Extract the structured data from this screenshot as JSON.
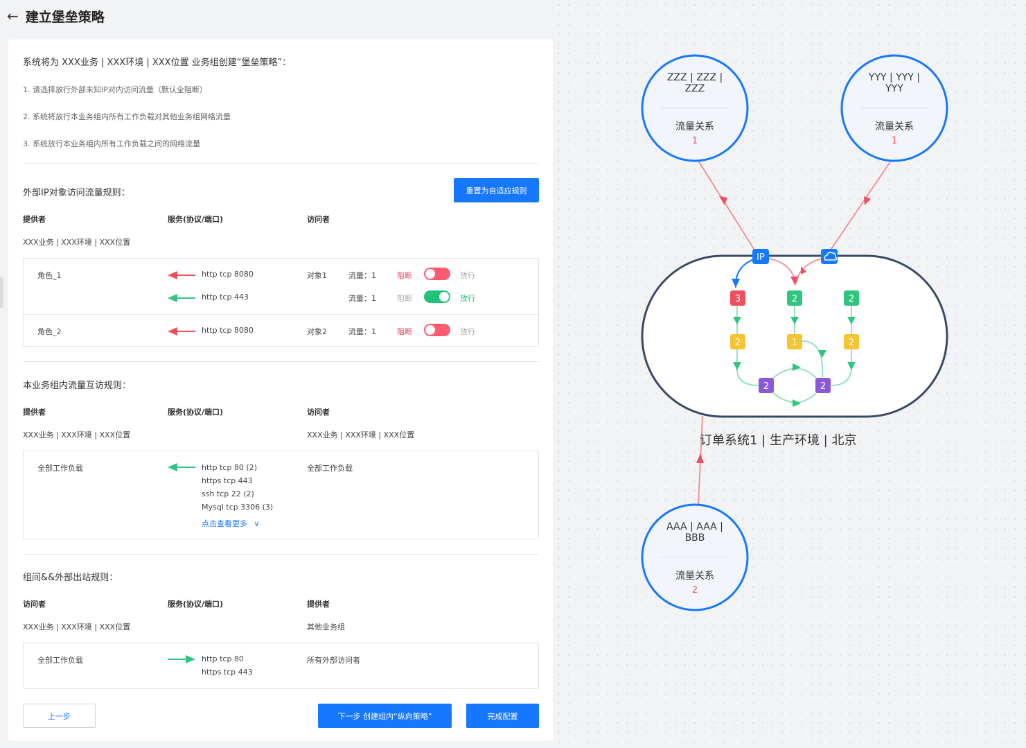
{
  "header": {
    "back_icon": "arrow-left-icon",
    "title": "建立堡垒策略"
  },
  "intro": {
    "title": "系统将为 XXX业务 | XXX环境 | XXX位置 业务组创建“堡垒策略”：",
    "lines": [
      "1. 请选择放行外部未知IP对内访问流量（默认全阻断）",
      "2. 系统将放行本业务组内所有工作负载对其他业务组网络流量",
      "3. 系统放行本业务组内所有工作负载之间的网络流量"
    ]
  },
  "external": {
    "title": "外部IP对象访问流量规则：",
    "reset_button": "重置为自适应规则",
    "headers": {
      "provider": "提供者",
      "service": "服务(协议/端口)",
      "visitor": "访问者"
    },
    "provider_value": "XXX业务 | XXX环境 | XXX位置",
    "rows": [
      {
        "role": "角色_1",
        "service": "http tcp 8080",
        "object": "对象1",
        "flow": "流量：1",
        "block": "阻断",
        "allow": "放行",
        "state": "block",
        "arrow": "red"
      },
      {
        "role": "",
        "service": "http tcp 443",
        "object": "",
        "flow": "流量：1",
        "block": "阻断",
        "allow": "放行",
        "state": "allow",
        "arrow": "green"
      },
      {
        "role": "角色_2",
        "service": "http tcp 8080",
        "object": "对象2",
        "flow": "流量：1",
        "block": "阻断",
        "allow": "放行",
        "state": "block",
        "arrow": "red"
      }
    ]
  },
  "internal": {
    "title": "本业务组内流量互访规则：",
    "headers": {
      "provider": "提供者",
      "service": "服务(协议/端口)",
      "visitor": "访问者"
    },
    "provider_value": "XXX业务 | XXX环境 | XXX位置",
    "visitor_value": "XXX业务 | XXX环境 | XXX位置",
    "row": {
      "provider": "全部工作负载",
      "services": [
        "http tcp 80 (2)",
        "https tcp 443",
        "ssh tcp 22 (2)",
        "Mysql tcp 3306 (3)"
      ],
      "more": "点击查看更多",
      "visitor": "全部工作负载"
    }
  },
  "outbound": {
    "title": "组间&&外部出站规则：",
    "headers": {
      "visitor": "访问者",
      "service": "服务(协议/端口)",
      "provider": "提供者"
    },
    "visitor_value": "XXX业务 | XXX环境 | XXX位置",
    "provider_value": "其他业务组",
    "row": {
      "visitor": "全部工作负载",
      "services": [
        "http tcp 80",
        "https tcp 443"
      ],
      "provider": "所有外部访问者"
    }
  },
  "footer": {
    "prev": "上一步",
    "next": "下一步 创建组内“纵向策略”",
    "finish": "完成配置"
  },
  "diagram": {
    "nodes": [
      {
        "name_line1": "ZZZ | ZZZ |",
        "name_line2": "ZZZ",
        "label": "流量关系",
        "count": "1"
      },
      {
        "name_line1": "YYY | YYY |",
        "name_line2": "YYY",
        "label": "流量关系",
        "count": "1"
      },
      {
        "name_line1": "AAA | AAA |",
        "name_line2": "BBB",
        "label": "流量关系",
        "count": "2"
      }
    ],
    "group_label": "订单系统1 | 生产环境 | 北京",
    "ip_badge": "IP",
    "cloud_badge": "cloud-icon",
    "boxes": [
      "3",
      "2",
      "2",
      "2",
      "1",
      "2",
      "2",
      "2"
    ],
    "colors": {
      "red": "#f0505e",
      "green": "#2fc57e",
      "yellow": "#f5c431",
      "purple": "#8a5ad6",
      "blue": "#1677ff"
    }
  }
}
